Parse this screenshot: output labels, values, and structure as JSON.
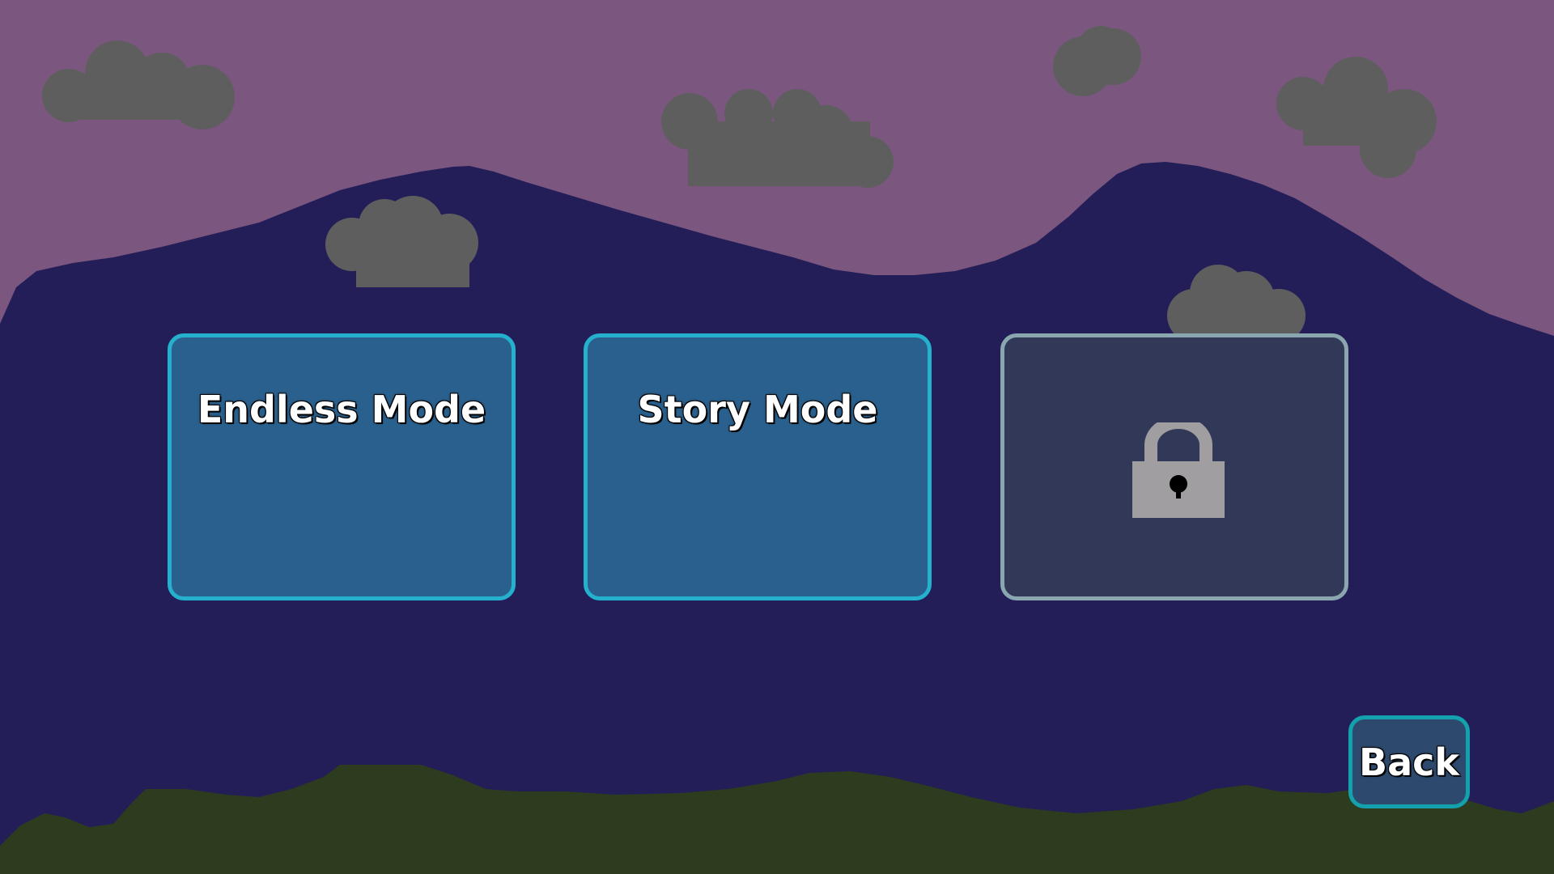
{
  "scene": {
    "sky_color": "#7b5780",
    "mountain_color": "#231e57",
    "ground_color": "#2d3b1f",
    "cloud_color": "#5e5e5e"
  },
  "mode_select": {
    "modes": [
      {
        "label": "Endless Mode",
        "locked": false
      },
      {
        "label": "Story Mode",
        "locked": false
      },
      {
        "label": "",
        "locked": true,
        "icon": "lock-icon"
      }
    ],
    "back_label": "Back"
  },
  "colors": {
    "card_bg": "#2a608d",
    "card_border": "#25b1cd",
    "locked_bg": "#313858",
    "locked_border": "#8aa6af",
    "back_bg": "#2d4a6e",
    "back_border": "#13a1ad"
  }
}
